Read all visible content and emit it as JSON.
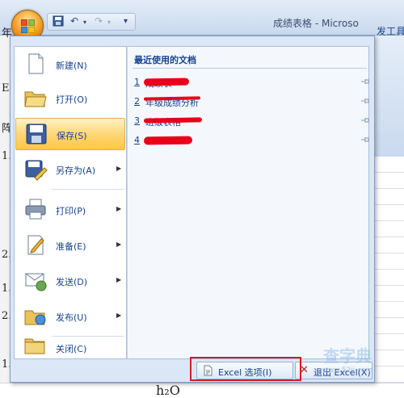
{
  "window": {
    "title": "成绩表格 - Microso",
    "ribbon_tab_partial": "发工具",
    "left_partial_text": [
      "年",
      "E",
      "阵",
      "1.",
      "2.",
      "1.",
      "2.",
      "1."
    ],
    "bottom_partial_text": "h₂O"
  },
  "quick_access": {
    "save_icon": "save-icon",
    "undo_icon": "undo-icon",
    "redo_icon": "redo-icon",
    "customize_icon": "customize-icon"
  },
  "menu": {
    "items": [
      {
        "label": "新建(N)",
        "icon": "new-document-icon",
        "has_submenu": false
      },
      {
        "label": "打开(O)",
        "icon": "open-folder-icon",
        "has_submenu": false
      },
      {
        "label": "保存(S)",
        "icon": "save-disk-icon",
        "has_submenu": false,
        "selected": true
      },
      {
        "label": "另存为(A)",
        "icon": "save-as-icon",
        "has_submenu": true
      },
      {
        "label": "打印(P)",
        "icon": "printer-icon",
        "has_submenu": true
      },
      {
        "label": "准备(E)",
        "icon": "prepare-icon",
        "has_submenu": true
      },
      {
        "label": "发送(D)",
        "icon": "send-icon",
        "has_submenu": true
      },
      {
        "label": "发布(U)",
        "icon": "publish-icon",
        "has_submenu": true
      },
      {
        "label": "关闭(C)",
        "icon": "close-folder-icon",
        "has_submenu": false
      }
    ],
    "recent": {
      "title": "最近使用的文档",
      "documents": [
        {
          "number": "1",
          "name": "成绩表"
        },
        {
          "number": "2",
          "name": "年级成绩分析"
        },
        {
          "number": "3",
          "name": "班级表格"
        },
        {
          "number": "4",
          "name": ""
        }
      ]
    },
    "footer": {
      "options_label": "Excel 选项(I)",
      "exit_label": "退出 Excel(X)"
    }
  },
  "watermark": {
    "text": "查字典",
    "subtext": "www.52ij.com"
  },
  "colors": {
    "menu_text": "#15428b",
    "selected_bg": "#ffd778",
    "highlight_box": "#d81920",
    "redaction": "#e8001a"
  }
}
